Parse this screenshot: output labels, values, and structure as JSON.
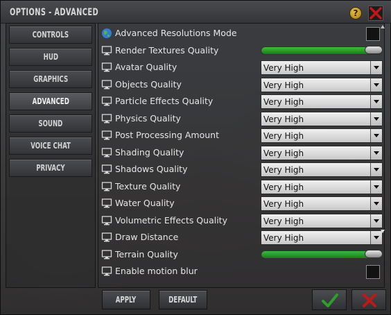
{
  "window": {
    "title": "OPTIONS - ADVANCED"
  },
  "nav": {
    "items": [
      {
        "label": "CONTROLS",
        "active": false
      },
      {
        "label": "HUD",
        "active": false
      },
      {
        "label": "GRAPHICS",
        "active": false
      },
      {
        "label": "ADVANCED",
        "active": true
      },
      {
        "label": "SOUND",
        "active": false
      },
      {
        "label": "VOICE CHAT",
        "active": false
      },
      {
        "label": "PRIVACY",
        "active": false
      }
    ]
  },
  "settings": [
    {
      "label": "Advanced Resolutions Mode",
      "icon": "globe-icon",
      "control": "checkbox",
      "checked": false
    },
    {
      "label": "Render Textures Quality",
      "icon": "monitor-icon",
      "control": "slider",
      "value": 1.0
    },
    {
      "label": "Avatar Quality",
      "icon": "monitor-icon",
      "control": "select",
      "value": "Very High"
    },
    {
      "label": "Objects Quality",
      "icon": "monitor-icon",
      "control": "select",
      "value": "Very High"
    },
    {
      "label": "Particle Effects Quality",
      "icon": "monitor-icon",
      "control": "select",
      "value": "Very High"
    },
    {
      "label": "Physics Quality",
      "icon": "monitor-icon",
      "control": "select",
      "value": "Very High"
    },
    {
      "label": "Post Processing Amount",
      "icon": "monitor-icon",
      "control": "select",
      "value": "Very High"
    },
    {
      "label": "Shading Quality",
      "icon": "monitor-icon",
      "control": "select",
      "value": "Very High"
    },
    {
      "label": "Shadows Quality",
      "icon": "monitor-icon",
      "control": "select",
      "value": "Very High"
    },
    {
      "label": "Texture Quality",
      "icon": "monitor-icon",
      "control": "select",
      "value": "Very High"
    },
    {
      "label": "Water Quality",
      "icon": "monitor-icon",
      "control": "select",
      "value": "Very High"
    },
    {
      "label": "Volumetric Effects Quality",
      "icon": "monitor-icon",
      "control": "select",
      "value": "Very High"
    },
    {
      "label": "Draw Distance",
      "icon": "monitor-icon",
      "control": "select",
      "value": "Very High"
    },
    {
      "label": "Terrain Quality",
      "icon": "monitor-icon",
      "control": "slider",
      "value": 1.0
    },
    {
      "label": "Enable motion blur",
      "icon": "monitor-icon",
      "control": "checkbox",
      "checked": false
    }
  ],
  "footer": {
    "apply_label": "APPLY",
    "default_label": "DEFAULT",
    "confirm_icon": "checkmark-icon",
    "cancel_icon": "close-icon"
  },
  "colors": {
    "accent_green": "#2e9e2e",
    "cancel_red": "#c01818",
    "help_gold": "#d4a020"
  }
}
